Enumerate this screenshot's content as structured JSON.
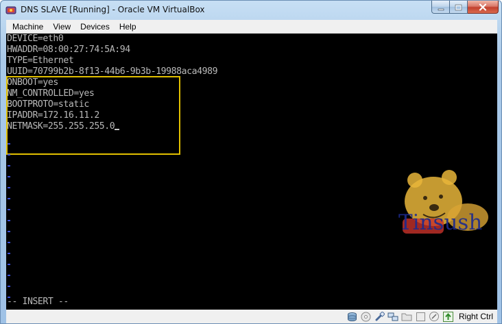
{
  "window": {
    "title": "DNS SLAVE [Running] - Oracle VM VirtualBox",
    "app_icon": "virtualbox-icon",
    "caption_buttons": [
      "minimize-icon",
      "maximize-icon",
      "close-icon"
    ]
  },
  "menubar": {
    "items": [
      "Machine",
      "View",
      "Devices",
      "Help"
    ]
  },
  "console": {
    "background": "#000000",
    "text_color": "#b9b9b9",
    "highlight_color": "#e2c000",
    "lines": [
      "DEVICE=eth0",
      "HWADDR=08:00:27:74:5A:94",
      "TYPE=Ethernet",
      "UUID=70799b2b-8f13-44b6-9b3b-19988aca4989",
      "ONBOOT=yes",
      "NM_CONTROLLED=yes",
      "BOOTPROTO=static",
      "IPADDR=172.16.11.2",
      "NETMASK=255.255.255.0"
    ],
    "mode": "-- INSERT --",
    "watermark": "Tinsush"
  },
  "statusbar": {
    "icons": [
      "hard-disk-icon",
      "optical-disk-icon",
      "usb-icon",
      "network-icon",
      "shared-folders-icon",
      "display-icon",
      "mouse-integration-icon",
      "host-key-arrow-icon"
    ],
    "host_key": "Right Ctrl"
  }
}
